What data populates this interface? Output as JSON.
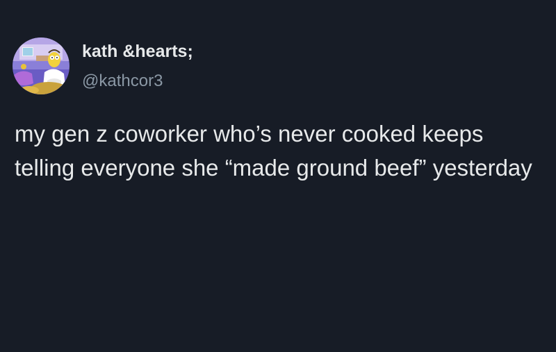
{
  "author": {
    "display_name": "kath &hearts;",
    "handle": "@kathcor3",
    "avatar_icon": "cartoon-profile-picture"
  },
  "tweet": {
    "text": "my gen z coworker who’s never cooked keeps telling everyone she “made ground beef” yesterday"
  },
  "colors": {
    "background": "#171c26",
    "primary_text": "#e7e9ea",
    "secondary_text": "#8b98a5"
  }
}
